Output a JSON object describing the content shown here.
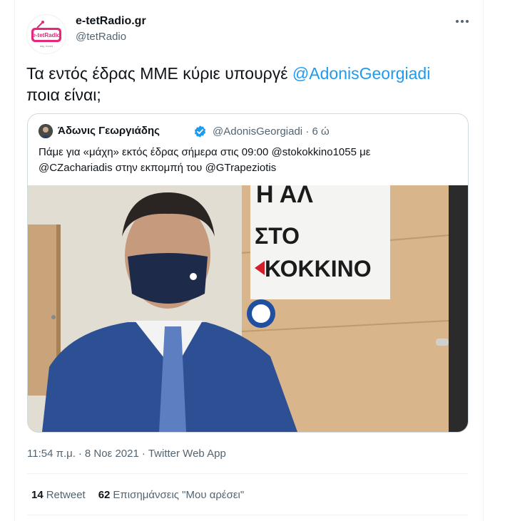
{
  "author": {
    "display_name": "e-tetRadio.gr",
    "handle": "@tetRadio",
    "avatar_logo_text": "e-tetRadio",
    "avatar_logo_subtext": "day, tuned"
  },
  "tweet": {
    "text_prefix": "Τα εντός έδρας ΜΜΕ κύριε υπουργέ ",
    "mention": "@AdonisGeorgiadi",
    "text_suffix": "ποια είναι;"
  },
  "quoted": {
    "display_name": "Άδωνις Γεωργιάδης",
    "handle": "@AdonisGeorgiadi",
    "time_sep": "·",
    "time": "6 ώ",
    "text_part1": "Πάμε για «μάχη» εκτός έδρας σήμερα στις 09:00 ",
    "mention1": "@stokokkino1055",
    "text_part2": " με",
    "mention2": "@CZachariadis",
    "text_part3": " στην εκπομπή του ",
    "mention3": "@GTrapeziotis",
    "photo_sign_top": "Η ΑΛ",
    "photo_sign_sto": "ΣΤΟ",
    "photo_sign_kokkino": "ΚΟΚΚΙΝΟ"
  },
  "meta": {
    "time": "11:54 π.μ.",
    "sep": "·",
    "date": "8 Νοε 2021",
    "source": "Twitter Web App"
  },
  "stats": {
    "retweets_count": "14",
    "retweets_label": "Retweet",
    "likes_count": "62",
    "likes_label": "Επισημάνσεις \"Μου αρέσει\""
  },
  "colors": {
    "accent": "#1d9bf0",
    "logo_pink": "#e5287a"
  }
}
